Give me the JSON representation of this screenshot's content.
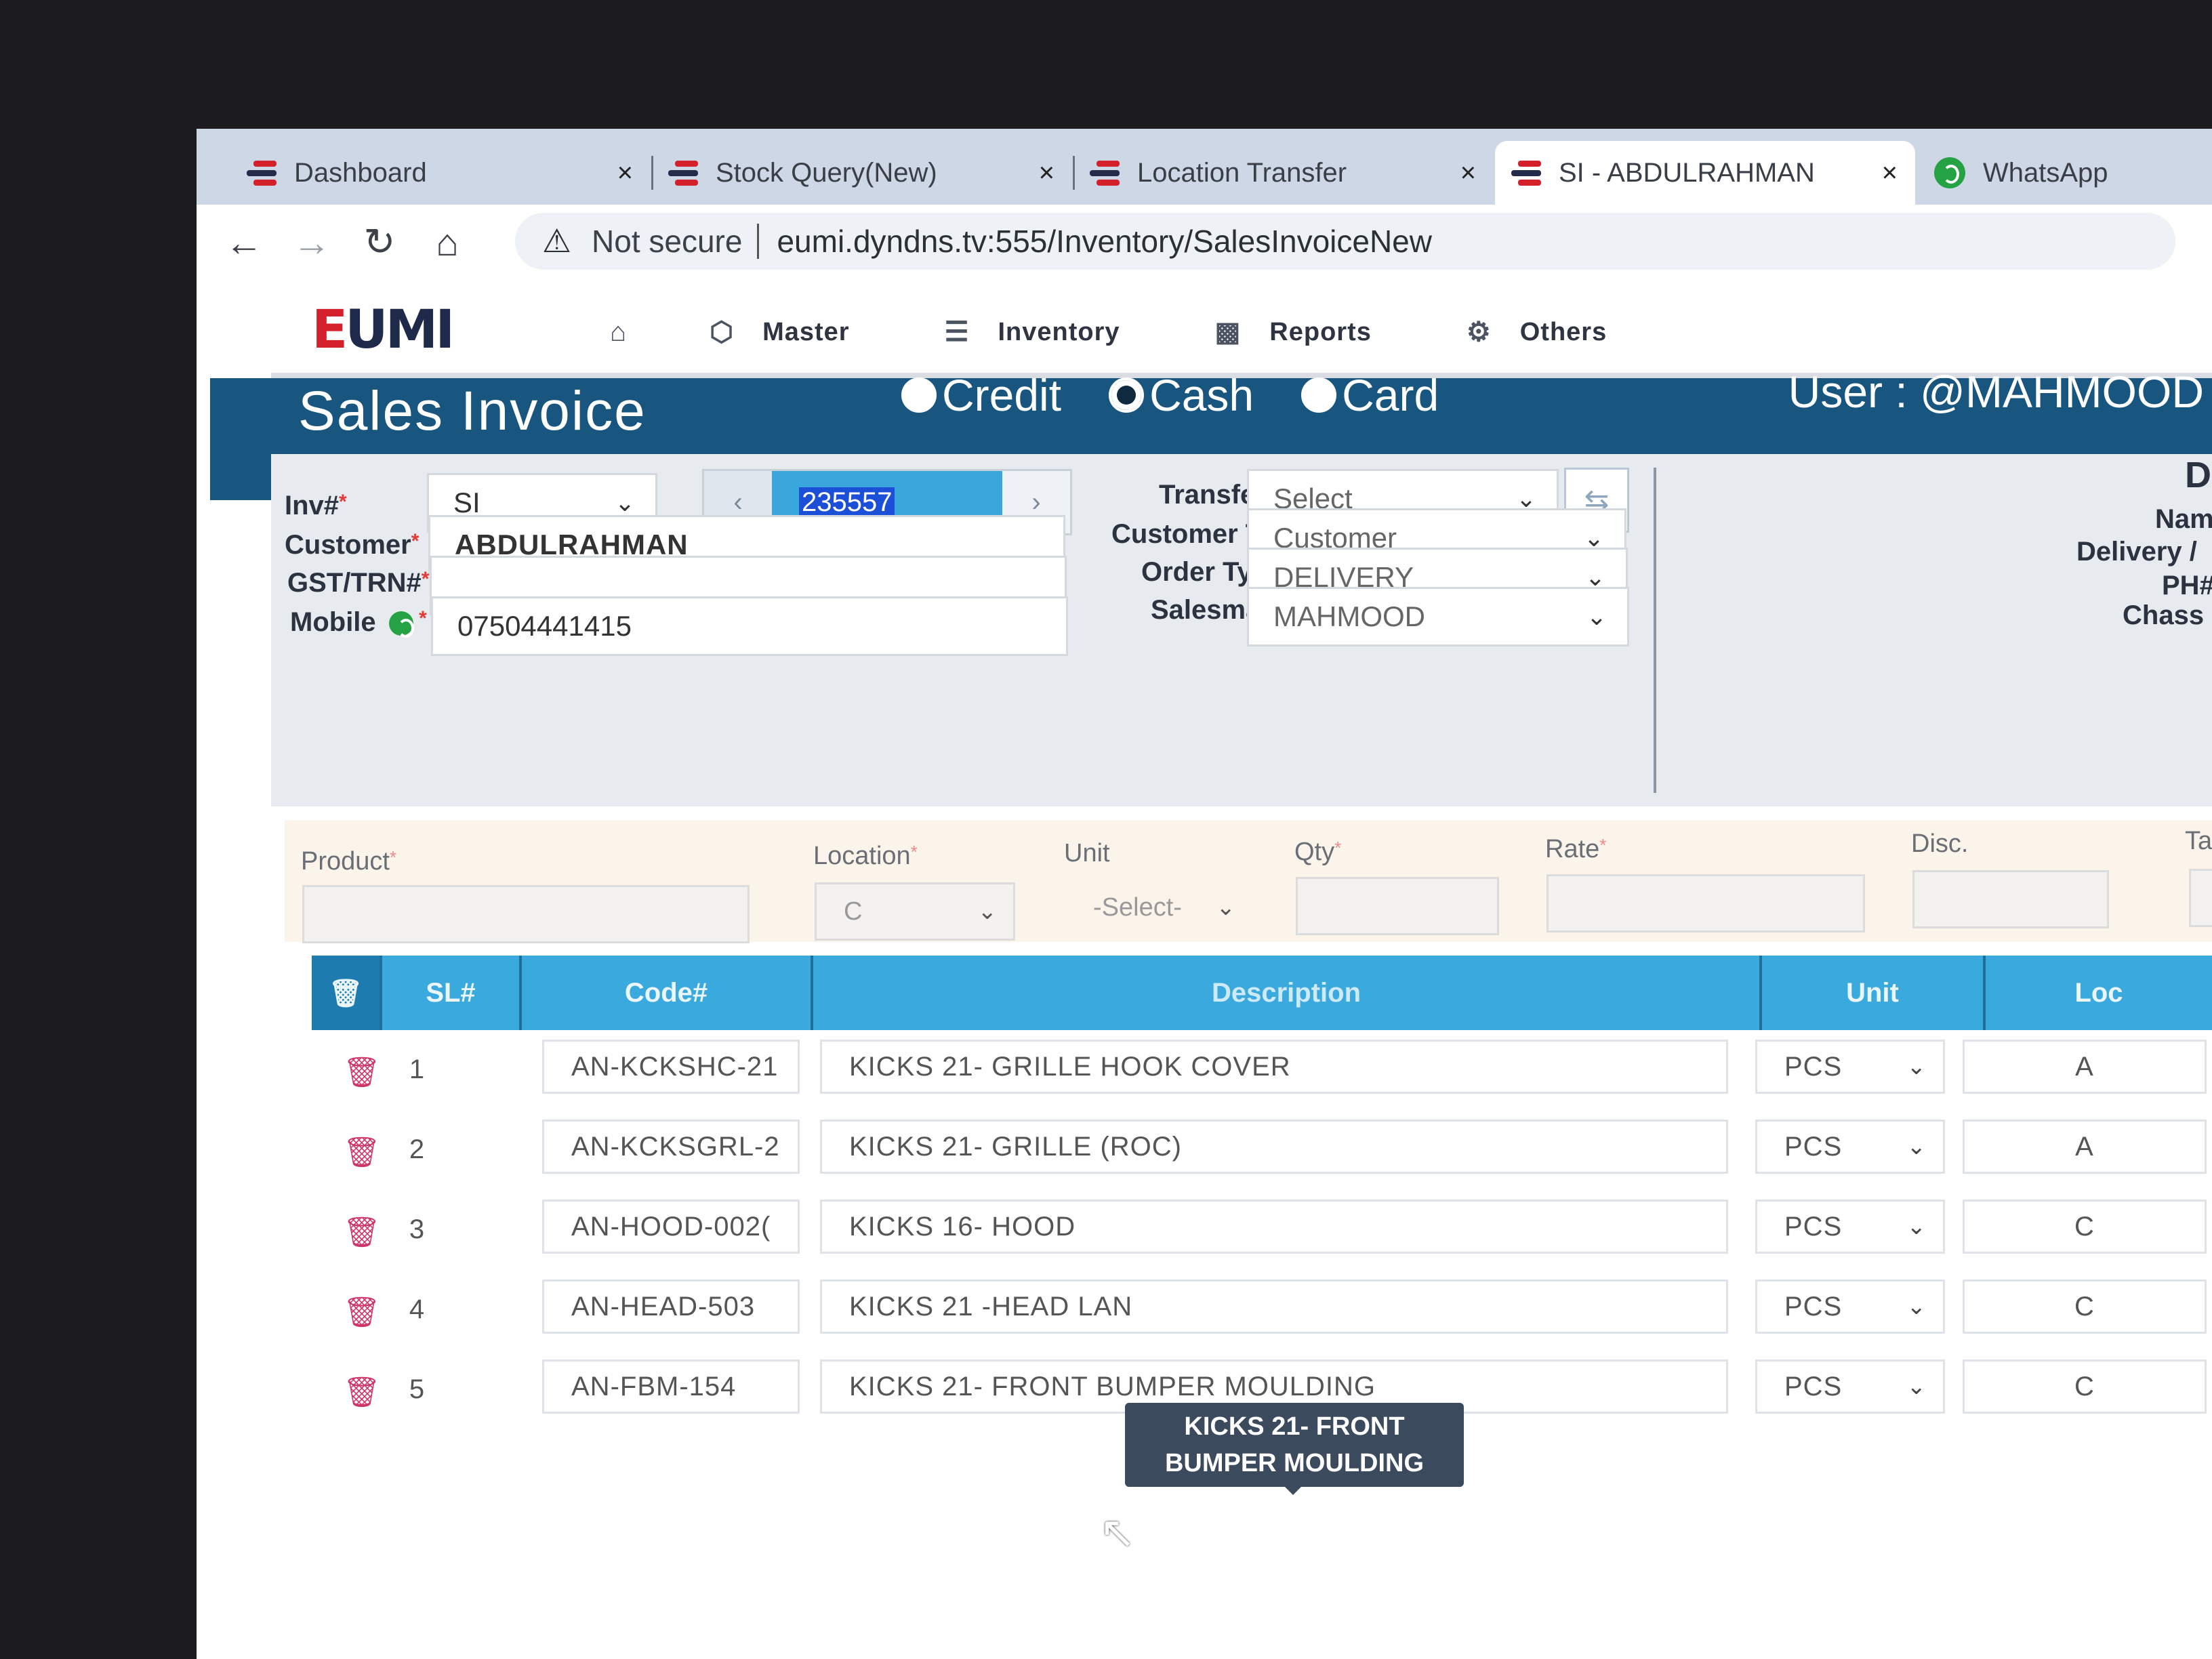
{
  "browser": {
    "tabs": [
      {
        "label": "Dashboard",
        "close": "×"
      },
      {
        "label": "Stock Query(New)",
        "close": "×"
      },
      {
        "label": "Location Transfer",
        "close": "×"
      },
      {
        "label": "SI - ABDULRAHMAN",
        "close": "×"
      },
      {
        "label": "WhatsApp"
      }
    ],
    "security_label": "Not secure",
    "url": "eumi.dyndns.tv:555/Inventory/SalesInvoiceNew"
  },
  "nav": {
    "logo_text": "EUMI",
    "items": [
      {
        "label": "Master",
        "icon": "cube-icon"
      },
      {
        "label": "Inventory",
        "icon": "layers-icon"
      },
      {
        "label": "Reports",
        "icon": "bar-chart-icon"
      },
      {
        "label": "Others",
        "icon": "gear-icon"
      }
    ]
  },
  "header": {
    "title": "Sales Invoice",
    "payment_types": [
      {
        "label": "Credit",
        "selected": false
      },
      {
        "label": "Cash",
        "selected": true
      },
      {
        "label": "Card",
        "selected": false
      }
    ],
    "user": "User : @MAHMOOD"
  },
  "form": {
    "inv_label": "Inv#",
    "inv_prefix": "SI",
    "inv_number": "235557",
    "customer_label": "Customer",
    "customer_value": "ABDULRAHMAN",
    "gst_label": "GST/TRN#",
    "gst_value": "",
    "mobile_label": "Mobile",
    "mobile_value": "07504441415",
    "transfer_label": "Transfer",
    "transfer_value": "Select",
    "customer_type_label": "Customer Type",
    "customer_type_value": "Customer",
    "order_type_label": "Order Type",
    "order_type_value": "DELIVERY",
    "salesman_label": "Salesman",
    "salesman_value": "MAHMOOD",
    "right_panel": {
      "heading": "D",
      "name_label": "Nam",
      "delivery_label": "Delivery /",
      "ph_label": "PH#",
      "chassis_label": "Chass"
    }
  },
  "entry": {
    "product_label": "Product",
    "location_label": "Location",
    "location_value": "C",
    "unit_label": "Unit",
    "unit_placeholder": "-Select-",
    "qty_label": "Qty",
    "rate_label": "Rate",
    "disc_label": "Disc.",
    "tax_label": "Ta"
  },
  "table": {
    "headers": [
      "SL#",
      "Code#",
      "Description",
      "Unit",
      "Loc"
    ],
    "rows": [
      {
        "sl": "1",
        "code": "AN-KCKSHC-21",
        "description": "KICKS 21- GRILLE HOOK COVER",
        "unit": "PCS",
        "loc": "A"
      },
      {
        "sl": "2",
        "code": "AN-KCKSGRL-2",
        "description": "KICKS 21- GRILLE  (ROC)",
        "unit": "PCS",
        "loc": "A"
      },
      {
        "sl": "3",
        "code": "AN-HOOD-002(",
        "description": "KICKS 16- HOOD",
        "unit": "PCS",
        "loc": "C"
      },
      {
        "sl": "4",
        "code": "AN-HEAD-503",
        "description": "KICKS 21 -HEAD LAN",
        "unit": "PCS",
        "loc": "C"
      },
      {
        "sl": "5",
        "code": "AN-FBM-154",
        "description": "KICKS 21- FRONT BUMPER MOULDING",
        "unit": "PCS",
        "loc": "C"
      }
    ],
    "tooltip_line1": "KICKS 21- FRONT",
    "tooltip_line2": "BUMPER MOULDING"
  }
}
